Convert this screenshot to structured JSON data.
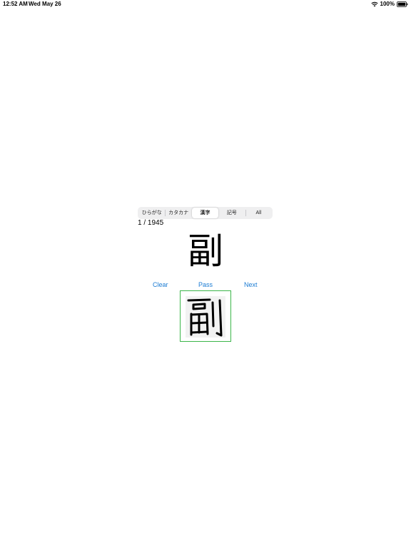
{
  "status_bar": {
    "time": "12:52 AM",
    "date": "Wed May 26",
    "battery": "100%",
    "icons": [
      "wifi-icon",
      "battery-icon"
    ]
  },
  "segments": {
    "items": [
      {
        "label": "ひらがな",
        "selected": false
      },
      {
        "label": "カタカナ",
        "selected": false
      },
      {
        "label": "漢字",
        "selected": true
      },
      {
        "label": "記号",
        "selected": false
      },
      {
        "label": "All",
        "selected": false
      }
    ]
  },
  "quiz": {
    "counter": "1 / 1945",
    "character": "副"
  },
  "actions": {
    "clear": "Clear",
    "pass": "Pass",
    "next": "Next"
  },
  "colors": {
    "accent": "#1a7bd3",
    "pad_border": "#3bb54a",
    "canvas_bg": "#f2f2f2"
  }
}
